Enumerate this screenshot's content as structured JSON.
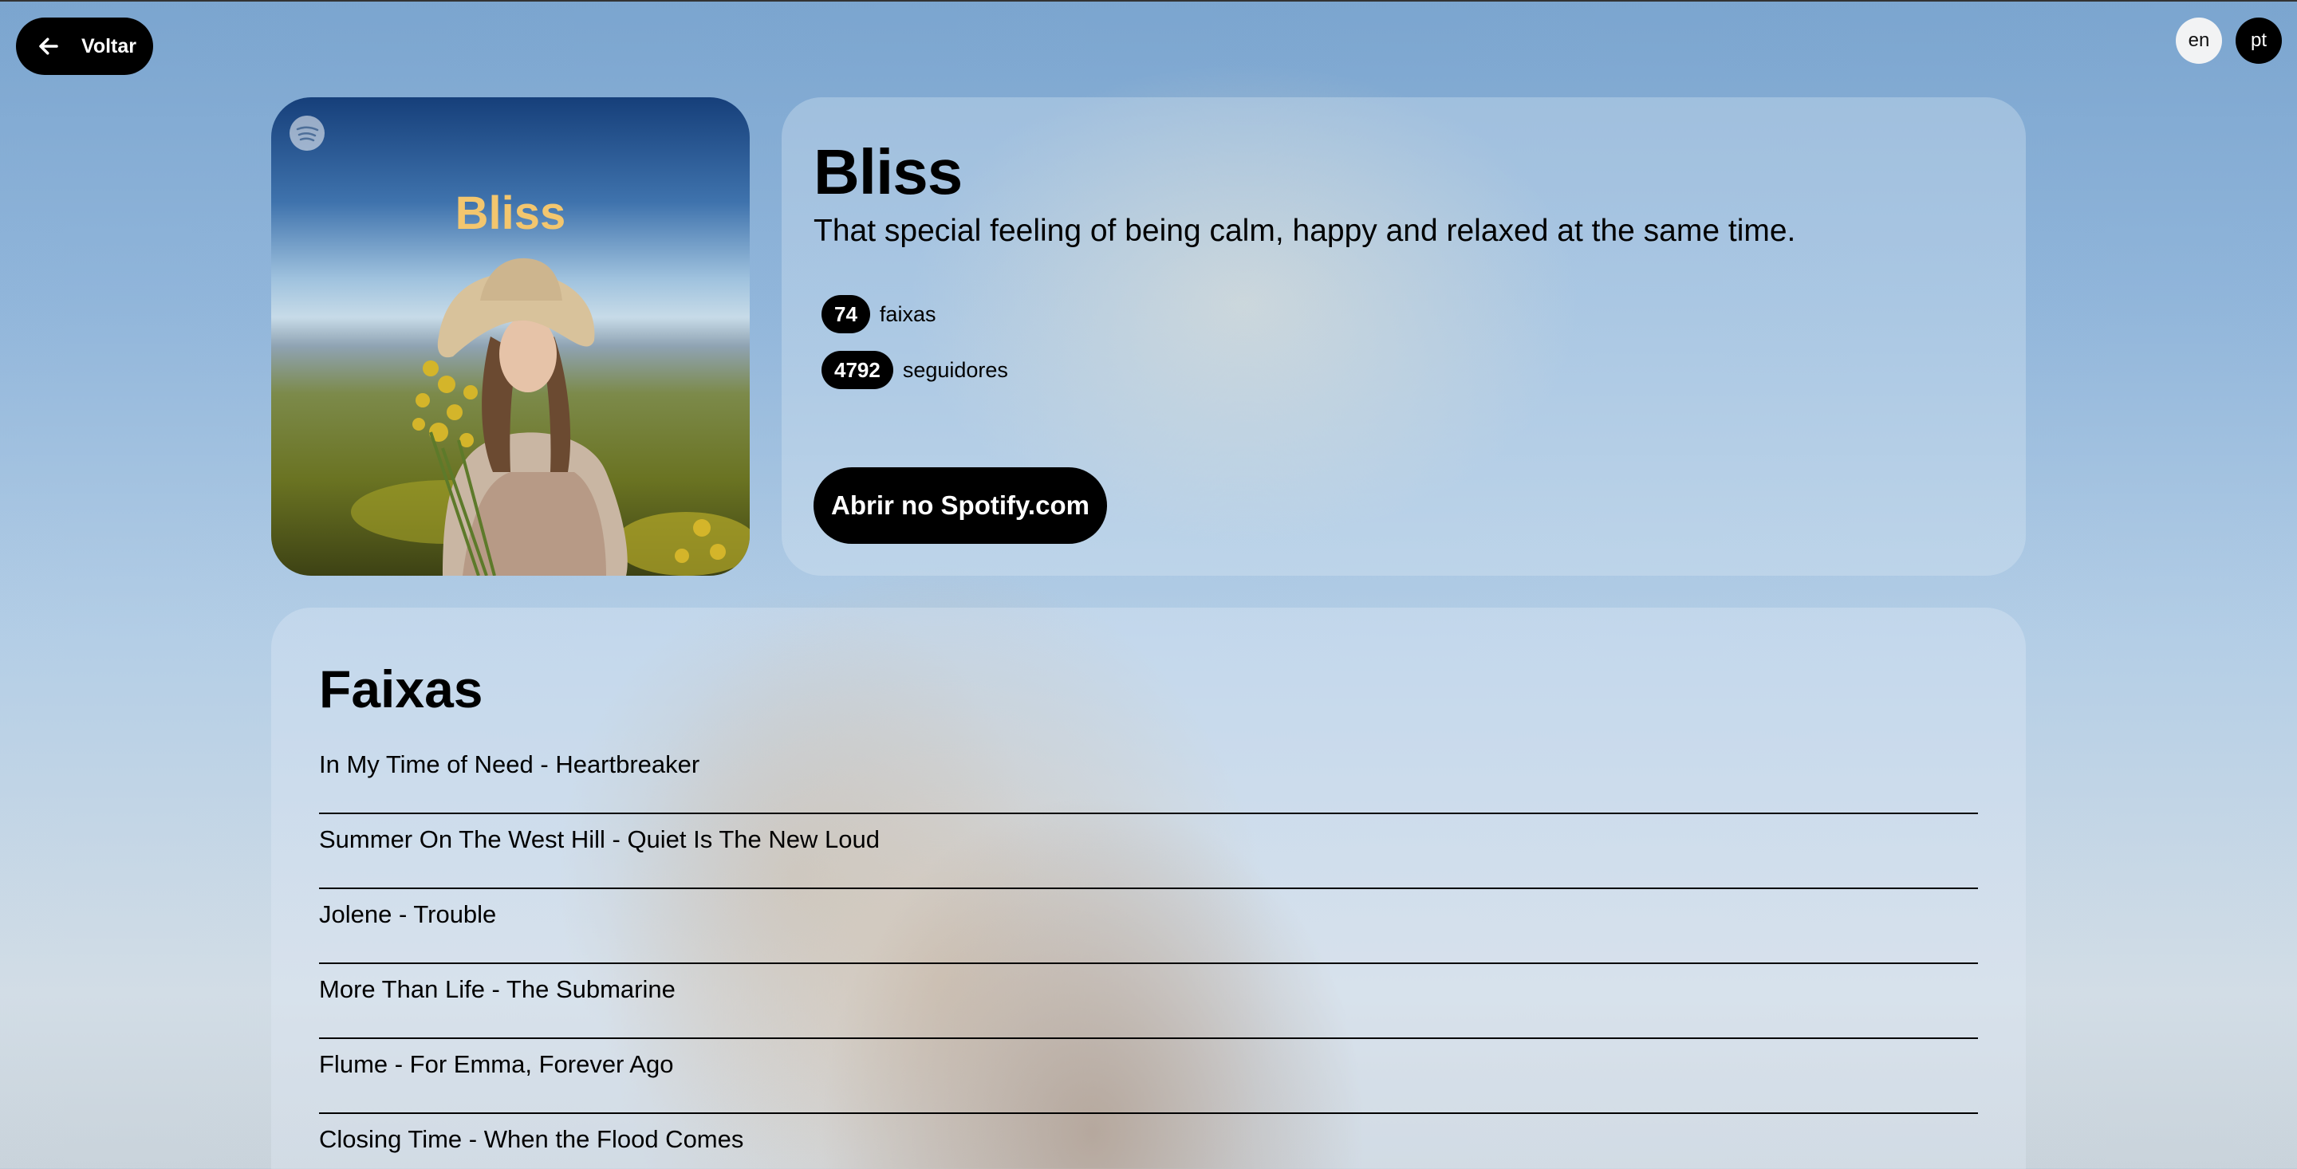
{
  "nav": {
    "back_label": "Voltar",
    "languages": [
      "en",
      "pt"
    ],
    "active_language": "pt"
  },
  "playlist": {
    "cover_title": "Bliss",
    "name": "Bliss",
    "description": "That special feeling of being calm, happy and relaxed at the same time.",
    "track_count": "74",
    "track_count_label": "faixas",
    "followers": "4792",
    "followers_label": "seguidores",
    "open_button": "Abrir no Spotify.com"
  },
  "tracks_section": {
    "title": "Faixas",
    "tracks": [
      "In My Time of Need - Heartbreaker",
      "Summer On The West Hill - Quiet Is The New Loud",
      "Jolene - Trouble",
      "More Than Life - The Submarine",
      "Flume - For Emma, Forever Ago",
      "Closing Time - When the Flood Comes"
    ]
  },
  "colors": {
    "accent": "#000000",
    "cover_title": "#f3c66e"
  }
}
